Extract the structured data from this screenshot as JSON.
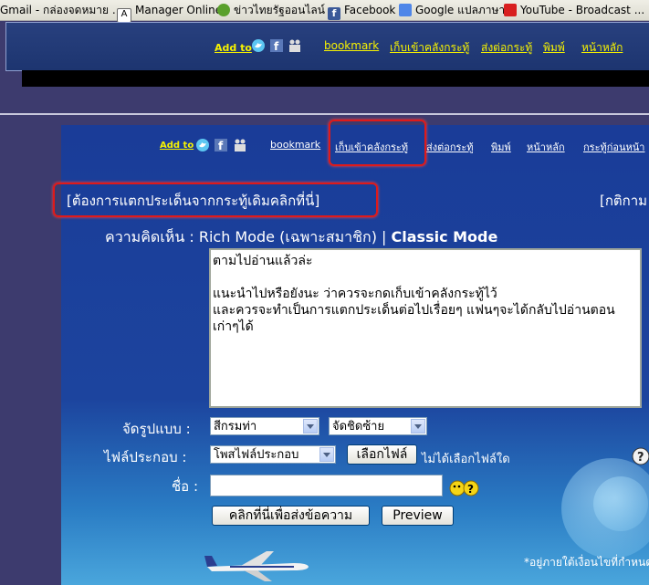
{
  "bookmarks": [
    {
      "label": "Gmail - กล่องจดหมาย ..."
    },
    {
      "label": "Manager Online"
    },
    {
      "label": "ข่าวไทยรัฐออนไลน์"
    },
    {
      "label": "Facebook"
    },
    {
      "label": "Google แปลภาษา"
    },
    {
      "label": "YouTube - Broadcast ..."
    }
  ],
  "header": {
    "add_to": "Add to",
    "links": [
      "bookmark",
      "เก็บเข้าคลังกระทู้",
      "ส่งต่อกระทู้",
      "พิมพ์",
      "หน้าหลัก"
    ]
  },
  "main_nav": {
    "add_to": "Add to",
    "links": [
      "bookmark",
      "เก็บเข้าคลังกระทู้",
      "ส่งต่อกระทู้",
      "พิมพ์",
      "หน้าหลัก",
      "กระทู้ก่อนหน้า"
    ]
  },
  "branch_link": "[ต้องการแตกประเด็นจากกระทู้เดิมคลิกที่นี่]",
  "rules_link": "[กติกาม",
  "comment": {
    "label": "ความคิดเห็น :",
    "rich_mode": "Rich Mode (เฉพาะสมาชิก)",
    "separator": "|",
    "classic_mode": "Classic Mode",
    "text": "ตามไปอ่านแล้วล่ะ\n\nแนะนำไปหรือยังนะ ว่าควรจะกดเก็บเข้าคลังกระทู้ไว้\nและควรจะทำเป็นการแตกประเด็นต่อไปเรื่อยๆ แฟนๆจะได้กลับไปอ่านตอนเก่าๆได้"
  },
  "format": {
    "label": "จัดรูปแบบ :",
    "color_value": "สีกรมท่า",
    "align_value": "จัดชิดซ้าย"
  },
  "attach": {
    "label": "ไฟล์ประกอบ :",
    "type_value": "โพสไฟล์ประกอบ",
    "choose_button": "เลือกไฟล์",
    "status": "ไม่ได้เลือกไฟล์ใด"
  },
  "name": {
    "label": "ชื่อ :",
    "value": ""
  },
  "buttons": {
    "submit": "คลิกที่นี่เพื่อส่งข้อความ",
    "preview": "Preview"
  },
  "footer_note": "*อยู่ภายใต้เงื่อนไขที่กำหนด",
  "icons": [
    "twitter-icon",
    "facebook-icon",
    "myspace-icon",
    "help-icon",
    "emoticon-icon"
  ],
  "colors": {
    "link_yellow": "#f6f200",
    "highlight_red": "#e01a1a",
    "panel_blue": "#1c449e"
  }
}
